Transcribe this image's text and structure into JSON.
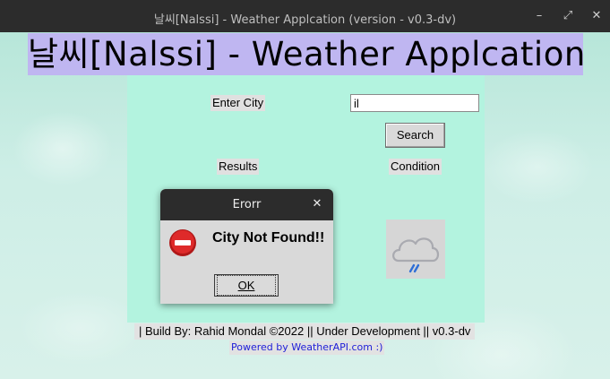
{
  "window": {
    "title": "날씨[Nalssi] - Weather Applcation (version - v0.3-dv)",
    "controls": {
      "minimize": "–",
      "maximize": "⤢",
      "close": "✕"
    }
  },
  "app": {
    "heading": "날씨[Nalssi] - Weather Applcation",
    "city_label": "Enter City",
    "city_value": "il",
    "search_label": "Search",
    "results_label": "Results",
    "condition_label": "Condition",
    "condition_icon": "rain-cloud-icon",
    "footer": "| Build By: Rahid Mondal ©2022 || Under Development || v0.3-dv",
    "powered_by": "Powered by WeatherAPI.com :)"
  },
  "dialog": {
    "title": "Erorr",
    "close": "✕",
    "message": "City Not Found!!",
    "ok_label": "OK",
    "icon": "error-stop-icon"
  },
  "colors": {
    "heading_bg": "#bfb6f1",
    "panel_bg": "#b3f3df",
    "titlebar_bg": "#2c2c2c",
    "link": "#1e1ed8",
    "error_red": "#d42020"
  }
}
